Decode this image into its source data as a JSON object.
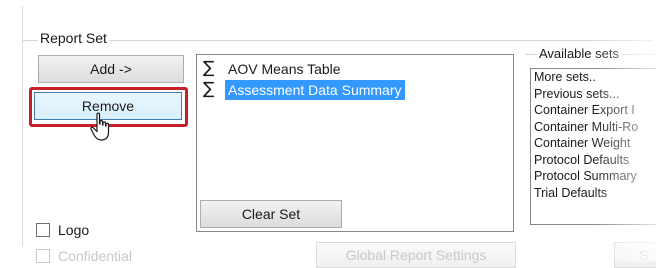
{
  "report_set": {
    "title": "Report Set",
    "add_label": "Add ->",
    "remove_label": "Remove",
    "clear_label": "Clear Set",
    "items": [
      {
        "icon": "sigma-icon",
        "label": "AOV Means Table",
        "selected": false
      },
      {
        "icon": "sigma-icon",
        "label": "Assessment Data Summary",
        "selected": true
      }
    ]
  },
  "available_sets": {
    "title": "Available sets",
    "items": [
      "More sets..",
      "Previous sets...",
      "Container Export I",
      "Container Multi-Ro",
      "Container Weight",
      "Protocol Defaults",
      "Protocol Summary",
      "Trial Defaults"
    ]
  },
  "options": {
    "logo_label": "Logo",
    "confidential_label": "Confidential"
  },
  "footer": {
    "global_settings_label": "Global Report Settings",
    "small_button_label": "S"
  },
  "colors": {
    "highlight": "#c41f2a",
    "selection": "#3399ff"
  }
}
